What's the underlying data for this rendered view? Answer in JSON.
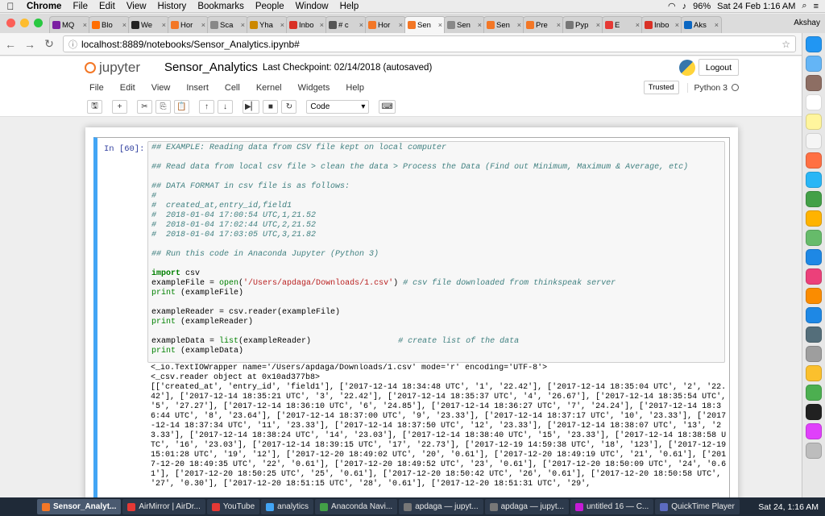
{
  "menubar": {
    "app": "Chrome",
    "items": [
      "File",
      "Edit",
      "View",
      "History",
      "Bookmarks",
      "People",
      "Window",
      "Help"
    ],
    "battery": "96%",
    "clock": "Sat 24 Feb  1:16 AM"
  },
  "tabs": [
    {
      "label": "MQ",
      "color": "#7b1fa2"
    },
    {
      "label": "Blo",
      "color": "#ff6d00"
    },
    {
      "label": "We",
      "color": "#222222"
    },
    {
      "label": "Hor",
      "color": "#f37726"
    },
    {
      "label": "Sca",
      "color": "#888888"
    },
    {
      "label": "Yha",
      "color": "#cc8800"
    },
    {
      "label": "Inbo",
      "color": "#d93025"
    },
    {
      "label": "# c",
      "color": "#555555"
    },
    {
      "label": "Hor",
      "color": "#f37726"
    },
    {
      "label": "Sen",
      "color": "#f37726"
    },
    {
      "label": "Sen",
      "color": "#888888"
    },
    {
      "label": "Sen",
      "color": "#f37726"
    },
    {
      "label": "Pre",
      "color": "#f37726"
    },
    {
      "label": "Pyp",
      "color": "#777777"
    },
    {
      "label": "E",
      "color": "#e53935"
    },
    {
      "label": "Inbo",
      "color": "#d93025"
    },
    {
      "label": "Aks",
      "color": "#0a66c2"
    }
  ],
  "active_tab_index": 9,
  "tab_user": "Akshay",
  "address": {
    "url": "localhost:8889/notebooks/Sensor_Analytics.ipynb#"
  },
  "jupyter": {
    "logo_text": "jupyter",
    "notebook_name": "Sensor_Analytics",
    "checkpoint": "Last Checkpoint: 02/14/2018 (autosaved)",
    "logout": "Logout",
    "menu": [
      "File",
      "Edit",
      "View",
      "Insert",
      "Cell",
      "Kernel",
      "Widgets",
      "Help"
    ],
    "trusted": "Trusted",
    "kernel_name": "Python 3",
    "cell_type": "Code"
  },
  "cell": {
    "prompt": "In [60]:",
    "code_lines": [
      [
        {
          "c": "c",
          "t": "## EXAMPLE: Reading data from CSV file kept on local computer"
        }
      ],
      [
        {
          "c": "",
          "t": ""
        }
      ],
      [
        {
          "c": "c",
          "t": "## Read data from local csv file > clean the data > Process the Data (Find out Minimum, Maximum & Average, etc)"
        }
      ],
      [
        {
          "c": "",
          "t": ""
        }
      ],
      [
        {
          "c": "c",
          "t": "## DATA FORMAT in csv file is as follows:"
        }
      ],
      [
        {
          "c": "c",
          "t": "#"
        }
      ],
      [
        {
          "c": "c",
          "t": "#  created_at,entry_id,field1"
        }
      ],
      [
        {
          "c": "c",
          "t": "#  2018-01-04 17:00:54 UTC,1,21.52"
        }
      ],
      [
        {
          "c": "c",
          "t": "#  2018-01-04 17:02:44 UTC,2,21.52"
        }
      ],
      [
        {
          "c": "c",
          "t": "#  2018-01-04 17:03:05 UTC,3,21.82"
        }
      ],
      [
        {
          "c": "",
          "t": ""
        }
      ],
      [
        {
          "c": "c",
          "t": "## Run this code in Anaconda Jupyter (Python 3)"
        }
      ],
      [
        {
          "c": "",
          "t": ""
        }
      ],
      [
        {
          "c": "k",
          "t": "import"
        },
        {
          "c": "",
          "t": " csv"
        }
      ],
      [
        {
          "c": "",
          "t": "exampleFile = "
        },
        {
          "c": "b",
          "t": "open"
        },
        {
          "c": "",
          "t": "("
        },
        {
          "c": "s",
          "t": "'/Users/apdaga/Downloads/1.csv'"
        },
        {
          "c": "",
          "t": ") "
        },
        {
          "c": "c",
          "t": "# csv file downloaded from thinkspeak server"
        }
      ],
      [
        {
          "c": "b",
          "t": "print"
        },
        {
          "c": "",
          "t": " (exampleFile)"
        }
      ],
      [
        {
          "c": "",
          "t": ""
        }
      ],
      [
        {
          "c": "",
          "t": "exampleReader = csv.reader(exampleFile)"
        }
      ],
      [
        {
          "c": "b",
          "t": "print"
        },
        {
          "c": "",
          "t": " (exampleReader)"
        }
      ],
      [
        {
          "c": "",
          "t": ""
        }
      ],
      [
        {
          "c": "",
          "t": "exampleData = "
        },
        {
          "c": "b",
          "t": "list"
        },
        {
          "c": "",
          "t": "(exampleReader)                  "
        },
        {
          "c": "c",
          "t": "# create list of the data"
        }
      ],
      [
        {
          "c": "b",
          "t": "print"
        },
        {
          "c": "",
          "t": " (exampleData)"
        }
      ]
    ],
    "output_lines": [
      "<_io.TextIOWrapper name='/Users/apdaga/Downloads/1.csv' mode='r' encoding='UTF-8'>",
      "<_csv.reader object at 0x10ad377b8>",
      "[['created_at', 'entry_id', 'field1'], ['2017-12-14 18:34:48 UTC', '1', '22.42'], ['2017-12-14 18:35:04 UTC', '2', '22.42'], ['2017-12-14 18:35:21 UTC', '3', '22.42'], ['2017-12-14 18:35:37 UTC', '4', '26.67'], ['2017-12-14 18:35:54 UTC', '5', '27.27'], ['2017-12-14 18:36:10 UTC', '6', '24.85'], ['2017-12-14 18:36:27 UTC', '7', '24.24'], ['2017-12-14 18:36:44 UTC', '8', '23.64'], ['2017-12-14 18:37:00 UTC', '9', '23.33'], ['2017-12-14 18:37:17 UTC', '10', '23.33'], ['2017-12-14 18:37:34 UTC', '11', '23.33'], ['2017-12-14 18:37:50 UTC', '12', '23.33'], ['2017-12-14 18:38:07 UTC', '13', '23.33'], ['2017-12-14 18:38:24 UTC', '14', '23.03'], ['2017-12-14 18:38:40 UTC', '15', '23.33'], ['2017-12-14 18:38:58 UTC', '16', '23.03'], ['2017-12-14 18:39:15 UTC', '17', '22.73'], ['2017-12-19 14:59:38 UTC', '18', '123'], ['2017-12-19 15:01:28 UTC', '19', '12'], ['2017-12-20 18:49:02 UTC', '20', '0.61'], ['2017-12-20 18:49:19 UTC', '21', '0.61'], ['2017-12-20 18:49:35 UTC', '22', '0.61'], ['2017-12-20 18:49:52 UTC', '23', '0.61'], ['2017-12-20 18:50:09 UTC', '24', '0.61'], ['2017-12-20 18:50:25 UTC', '25', '0.61'], ['2017-12-20 18:50:42 UTC', '26', '0.61'], ['2017-12-20 18:50:58 UTC', '27', '0.30'], ['2017-12-20 18:51:15 UTC', '28', '0.61'], ['2017-12-20 18:51:31 UTC', '29',"
    ]
  },
  "taskbar": {
    "items": [
      {
        "label": "Sensor_Analyt...",
        "color": "#f37726",
        "active": true
      },
      {
        "label": "AirMirror | AirDr...",
        "color": "#e53935",
        "active": false
      },
      {
        "label": "YouTube",
        "color": "#e53935",
        "active": false
      },
      {
        "label": "analytics",
        "color": "#42a5f5",
        "active": false
      },
      {
        "label": "Anaconda Navi...",
        "color": "#43a047",
        "active": false
      },
      {
        "label": "apdaga — jupyt...",
        "color": "#777777",
        "active": false
      },
      {
        "label": "apdaga — jupyt...",
        "color": "#777777",
        "active": false
      },
      {
        "label": "untitled 16 — C...",
        "color": "#c51bd6",
        "active": false
      },
      {
        "label": "QuickTime Player",
        "color": "#5c6bc0",
        "active": false
      }
    ],
    "clock": "Sat 24, 1:16 AM"
  },
  "dock": {
    "icons": [
      {
        "name": "globe-icon",
        "color": "#2196f3"
      },
      {
        "name": "preview-icon",
        "color": "#64b5f6"
      },
      {
        "name": "notebook-icon",
        "color": "#8d6e63"
      },
      {
        "name": "calendar-icon",
        "color": "#ffffff"
      },
      {
        "name": "notes-icon",
        "color": "#fff59d"
      },
      {
        "name": "reminders-icon",
        "color": "#f5f5f5"
      },
      {
        "name": "photos-icon",
        "color": "#ff7043"
      },
      {
        "name": "messages-icon",
        "color": "#29b6f6"
      },
      {
        "name": "facetime-icon",
        "color": "#43a047"
      },
      {
        "name": "sketch-icon",
        "color": "#ffb300"
      },
      {
        "name": "numbers-icon",
        "color": "#66bb6a"
      },
      {
        "name": "keynote-icon",
        "color": "#1e88e5"
      },
      {
        "name": "music-icon",
        "color": "#ec407a"
      },
      {
        "name": "books-icon",
        "color": "#fb8c00"
      },
      {
        "name": "appstore-icon",
        "color": "#1e88e5"
      },
      {
        "name": "quicktime-icon",
        "color": "#546e7a"
      },
      {
        "name": "settings-icon",
        "color": "#9e9e9e"
      },
      {
        "name": "chrome-icon",
        "color": "#fbc02d"
      },
      {
        "name": "spinner-icon",
        "color": "#4caf50"
      },
      {
        "name": "terminal-icon",
        "color": "#212121"
      },
      {
        "name": "flower-icon",
        "color": "#e040fb"
      },
      {
        "name": "trash-icon",
        "color": "#bdbdbd"
      }
    ]
  }
}
